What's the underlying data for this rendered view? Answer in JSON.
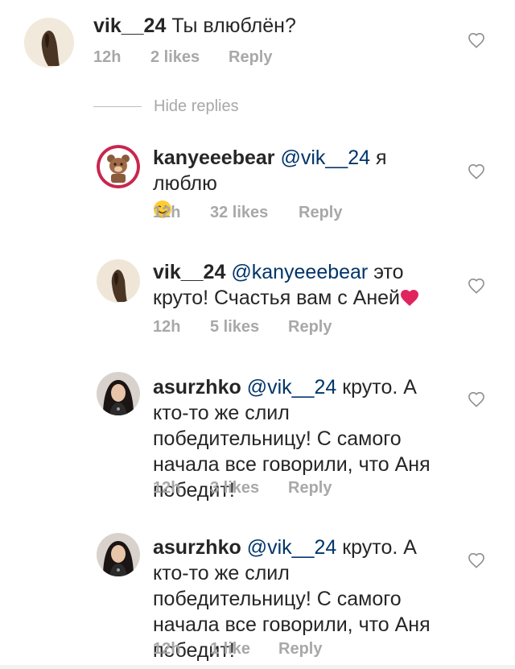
{
  "comments": [
    {
      "username": "vik__24",
      "mention": "",
      "text": " Ты влюблён?",
      "time": "12h",
      "likes": "2 likes",
      "reply": "Reply"
    },
    {
      "username": "kanyeeebear",
      "mention": "@vik__24",
      "text": " я люблю",
      "time": "12h",
      "likes": "32 likes",
      "reply": "Reply",
      "emoji": "winking-face-emoji"
    },
    {
      "username": "vik__24",
      "mention": "@kanyeeebear",
      "text": " это круто! Счастья вам с Аней",
      "time": "12h",
      "likes": "5 likes",
      "reply": "Reply",
      "emoji": "red-heart-emoji"
    },
    {
      "username": "asurzhko",
      "mention": "@vik__24",
      "text": " круто. А кто-то же слил победительницу! С самого начала все говорили, что Аня победит!",
      "time": "12h",
      "likes": "3 likes",
      "reply": "Reply"
    },
    {
      "username": "asurzhko",
      "mention": "@vik__24",
      "text": " круто. А кто-то же слил победительницу! С самого начала все говорили, что Аня победит!",
      "time": "12h",
      "likes": "1 like",
      "reply": "Reply"
    }
  ],
  "hide_replies": "Hide replies",
  "icons": {
    "like": "heart-outline-icon"
  },
  "colors": {
    "text": "#262626",
    "mention": "#003569",
    "meta": "#a8a8a8",
    "heart_emoji": "#e0245e"
  }
}
